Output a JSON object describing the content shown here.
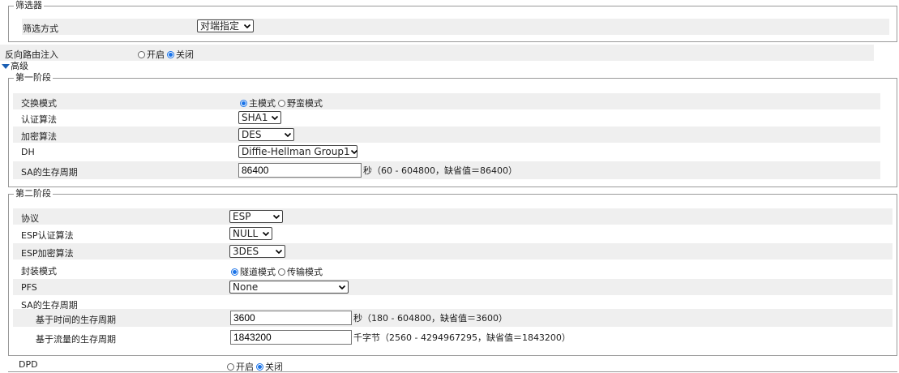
{
  "filter": {
    "legend": "筛选器",
    "mode_label": "筛选方式",
    "mode_value": "对端指定"
  },
  "reverse_route": {
    "label": "反向路由注入",
    "options": [
      "开启",
      "关闭"
    ],
    "selected": "关闭"
  },
  "advanced": {
    "label": "高级"
  },
  "phase1": {
    "legend": "第一阶段",
    "exchange_mode_label": "交换模式",
    "exchange_modes": [
      "主模式",
      "野蛮模式"
    ],
    "exchange_selected": "主模式",
    "auth_label": "认证算法",
    "auth_value": "SHA1",
    "enc_label": "加密算法",
    "enc_value": "DES",
    "dh_label": "DH",
    "dh_value": "Diffie-Hellman Group1",
    "sa_label": "SA的生存周期",
    "sa_value": "86400",
    "sa_hint": "秒（60 - 604800，缺省值＝86400）"
  },
  "phase2": {
    "legend": "第二阶段",
    "protocol_label": "协议",
    "protocol_value": "ESP",
    "esp_auth_label": "ESP认证算法",
    "esp_auth_value": "NULL",
    "esp_enc_label": "ESP加密算法",
    "esp_enc_value": "3DES",
    "encap_label": "封装模式",
    "encap_modes": [
      "隧道模式",
      "传输模式"
    ],
    "encap_selected": "隧道模式",
    "pfs_label": "PFS",
    "pfs_value": "None",
    "sa_label": "SA的生存周期",
    "time_label": "基于时间的生存周期",
    "time_value": "3600",
    "time_hint": "秒（180 - 604800，缺省值＝3600）",
    "traffic_label": "基于流量的生存周期",
    "traffic_value": "1843200",
    "traffic_hint": "千字节（2560 - 4294967295，缺省值＝1843200）"
  },
  "dpd": {
    "label": "DPD",
    "options": [
      "开启",
      "关闭"
    ],
    "selected": "关闭"
  },
  "colors": {
    "accent": "#1a73e8",
    "row_shade": "#efefef",
    "border": "#9a9a9a"
  }
}
